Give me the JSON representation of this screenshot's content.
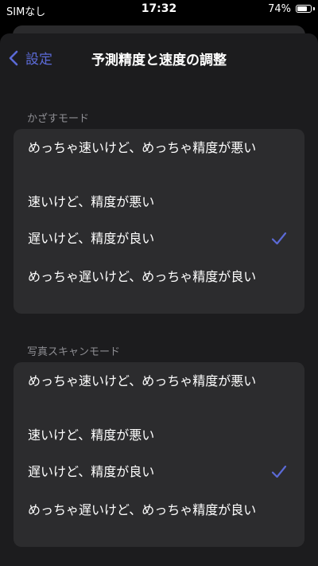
{
  "status_bar": {
    "carrier": "SIMなし",
    "time": "17:32",
    "battery_percent": "74%",
    "battery_level": 0.74
  },
  "nav": {
    "back_label": "設定",
    "title": "予測精度と速度の調整"
  },
  "accent_color": "#5b6ad6",
  "sections": [
    {
      "header": "かざすモード",
      "options": [
        {
          "label": "めっちゃ速いけど、めっちゃ精度が悪い",
          "selected": false
        },
        {
          "label": "速いけど、精度が悪い",
          "selected": false
        },
        {
          "label": "遅いけど、精度が良い",
          "selected": true
        },
        {
          "label": "めっちゃ遅いけど、めっちゃ精度が良い",
          "selected": false
        }
      ]
    },
    {
      "header": "写真スキャンモード",
      "options": [
        {
          "label": "めっちゃ速いけど、めっちゃ精度が悪い",
          "selected": false
        },
        {
          "label": "速いけど、精度が悪い",
          "selected": false
        },
        {
          "label": "遅いけど、精度が良い",
          "selected": true
        },
        {
          "label": "めっちゃ遅いけど、めっちゃ精度が良い",
          "selected": false
        }
      ]
    }
  ]
}
